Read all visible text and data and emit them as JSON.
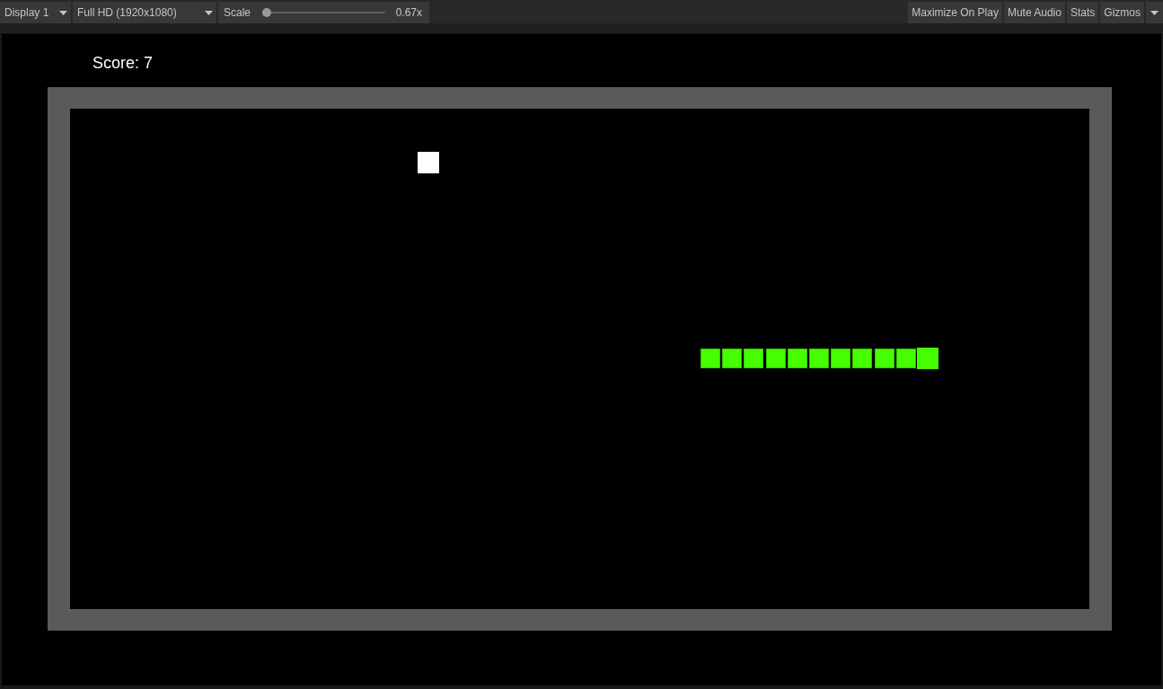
{
  "toolbar": {
    "display": {
      "label": "Display 1"
    },
    "resolution": {
      "label": "Full HD (1920x1080)"
    },
    "scale": {
      "label": "Scale",
      "level": 0,
      "reading": "0.67x"
    },
    "toggles": [
      {
        "label": "Maximize On Play",
        "on": false
      },
      {
        "label": "Mute Audio",
        "on": false
      },
      {
        "label": "Stats",
        "on": false
      },
      {
        "label": "Gizmos",
        "on": false
      }
    ]
  },
  "game": {
    "score": "Score: 7",
    "food": {
      "kind": "food"
    },
    "snake": [
      {
        "kind": "body"
      },
      {
        "kind": "body"
      },
      {
        "kind": "body"
      },
      {
        "kind": "body"
      },
      {
        "kind": "body"
      },
      {
        "kind": "body"
      },
      {
        "kind": "body"
      },
      {
        "kind": "body"
      },
      {
        "kind": "body"
      },
      {
        "kind": "body"
      },
      {
        "kind": "head"
      }
    ]
  }
}
